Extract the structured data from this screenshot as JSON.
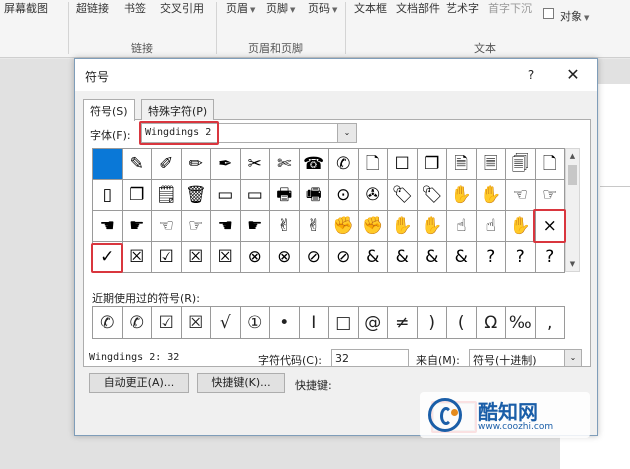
{
  "ribbon": {
    "items": [
      "屏幕截图",
      "超链接",
      "书签",
      "交叉引用",
      "页眉",
      "页脚",
      "页码",
      "文本框",
      "文档部件",
      "艺术字",
      "首字下沉",
      "对象"
    ],
    "groups": [
      "链接",
      "页眉和页脚",
      "文本"
    ]
  },
  "dialog": {
    "title": "符号",
    "help": "?",
    "close": "✕",
    "tabs": [
      "符号(S)",
      "特殊字符(P)"
    ],
    "font_label": "字体(F):",
    "font_value": "Wingdings 2",
    "recent_label": "近期使用过的符号(R):",
    "charset_name": "Wingdings 2: 32",
    "char_code_label": "字符代码(C):",
    "char_code_value": "32",
    "from_label": "来自(M):",
    "from_value": "符号(十进制)",
    "autocorrect_button": "自动更正(A)...",
    "shortcut_button": "快捷键(K)...",
    "shortcut_label": "快捷键:"
  },
  "symbols": {
    "rows": [
      [
        "",
        "✎",
        "✐",
        "✏",
        "✒",
        "✂",
        "✄",
        "☎",
        "✆",
        "🗋",
        "☐",
        "❐",
        "🗎",
        "🗏",
        "🗐",
        "🗋"
      ],
      [
        "▯",
        "❐",
        "🗒",
        "🗑",
        "▭",
        "▭",
        "🖶",
        "🖷",
        "⊙",
        "✇",
        "🏷",
        "🏷",
        "✋",
        "✋",
        "☜",
        "☞"
      ],
      [
        "☚",
        "☛",
        "☜",
        "☞",
        "☚",
        "☛",
        "✌",
        "✌",
        "✊",
        "✊",
        "✋",
        "✋",
        "☝",
        "☝",
        "✋",
        "×"
      ],
      [
        "✓",
        "☒",
        "☑",
        "☒",
        "☒",
        "⊗",
        "⊗",
        "⊘",
        "⊘",
        "&",
        "&",
        "&",
        "&",
        "?",
        "?",
        "?"
      ]
    ]
  },
  "recent_symbols": [
    "✆",
    "✆",
    "☑",
    "☒",
    "√",
    "①",
    "•",
    "I",
    "□",
    "@",
    "≠",
    ")",
    "(",
    "Ω",
    "‰",
    ","
  ],
  "watermark": {
    "name": "酷知网",
    "url": "www.coozhi.com"
  },
  "colors": {
    "accent": "#0a78d7",
    "highlight": "#d9363e"
  }
}
